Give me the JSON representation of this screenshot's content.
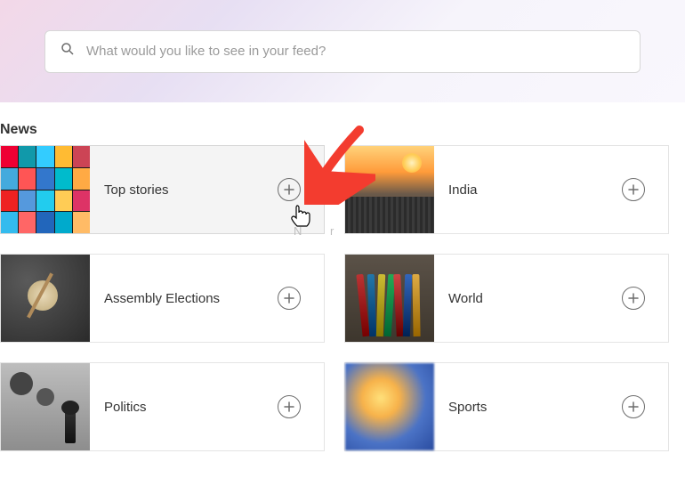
{
  "search": {
    "placeholder": "What would you like to see in your feed?"
  },
  "section": {
    "title": "News"
  },
  "cards": {
    "top_stories": "Top stories",
    "india": "India",
    "assembly_elections": "Assembly Elections",
    "world": "World",
    "politics": "Politics",
    "sports": "Sports"
  },
  "annotation": {
    "arrow_color": "#f33c2f",
    "ghost_text": "N     r"
  }
}
